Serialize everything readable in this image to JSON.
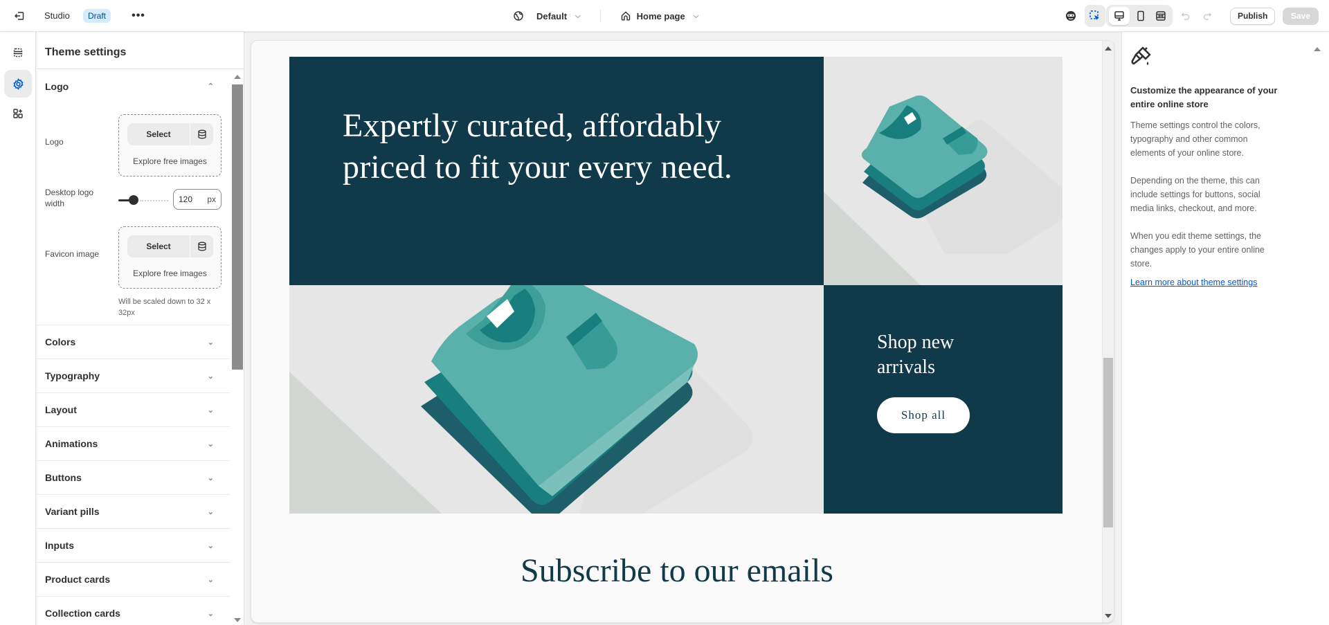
{
  "topbar": {
    "exit_icon": "exit-icon",
    "app_name": "Studio",
    "status_badge": "Draft",
    "more_icon": "•••",
    "theme_dropdown": {
      "icon": "globe-icon",
      "label": "Default"
    },
    "page_dropdown": {
      "icon": "home-icon",
      "label": "Home page"
    },
    "tools": [
      "accessibility-icon",
      "inspector-icon",
      "desktop-icon",
      "mobile-icon",
      "fullwidth-icon",
      "undo-icon",
      "redo-icon"
    ],
    "publish_label": "Publish",
    "save_label": "Save",
    "accent_color": "#005bd3"
  },
  "rail": {
    "items": [
      {
        "name": "sections",
        "icon": "sections-icon",
        "active": false
      },
      {
        "name": "theme-settings",
        "icon": "gear-icon",
        "active": true
      },
      {
        "name": "apps",
        "icon": "apps-icon",
        "active": false
      }
    ]
  },
  "settings_panel": {
    "title": "Theme settings",
    "open_section": {
      "title": "Logo",
      "logo": {
        "label": "Logo",
        "select_label": "Select",
        "explore_label": "Explore free images"
      },
      "logo_width": {
        "label": "Desktop logo width",
        "value": "120",
        "unit": "px",
        "slider_fraction": 0.25
      },
      "favicon": {
        "label": "Favicon image",
        "select_label": "Select",
        "explore_label": "Explore free images",
        "hint": "Will be scaled down to 32 x 32px"
      }
    },
    "sections": [
      "Colors",
      "Typography",
      "Layout",
      "Animations",
      "Buttons",
      "Variant pills",
      "Inputs",
      "Product cards",
      "Collection cards"
    ]
  },
  "preview": {
    "hero_heading": "Expertly curated, affordably priced to fit your every need.",
    "cta_heading": "Shop new arrivals",
    "cta_button": "Shop all",
    "subscribe_heading": "Subscribe to our emails",
    "colors": {
      "dark": "#10394a",
      "shirt_light": "#5ab0ab",
      "shirt_mid": "#187f7e",
      "shirt_dark": "#1e5e68"
    }
  },
  "info_panel": {
    "icon": "paintbrush-icon",
    "title": "Customize the appearance of your entire online store",
    "paragraphs": [
      "Theme settings control the colors, typography and other common elements of your online store.",
      "Depending on the theme, this can include settings for buttons, social media links, checkout, and more.",
      "When you edit theme settings, the changes apply to your entire online store."
    ],
    "link": "Learn more about theme settings"
  }
}
